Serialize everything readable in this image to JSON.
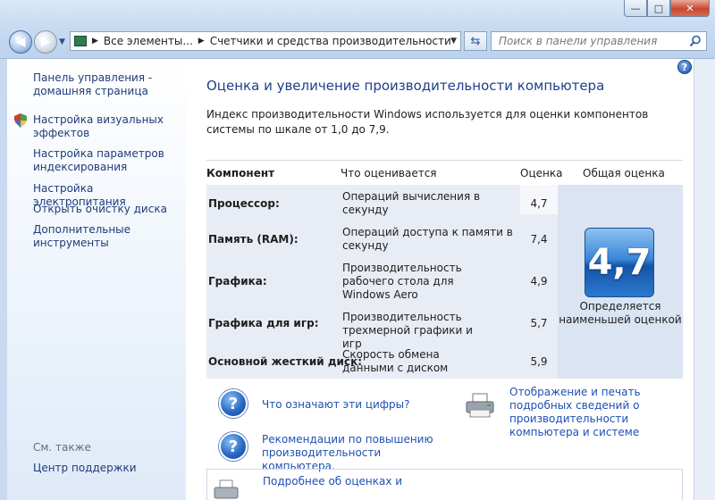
{
  "window": {
    "minimize": "—",
    "maximize": "□",
    "close": "✕"
  },
  "address": {
    "crumb1": "Все элементы...",
    "crumb2": "Счетчики и средства производительности"
  },
  "search": {
    "placeholder": "Поиск в панели управления"
  },
  "sidebar": {
    "items": [
      {
        "label": "Панель управления - домашняя страница"
      },
      {
        "label": "Настройка визуальных эффектов"
      },
      {
        "label": "Настройка параметров индексирования"
      },
      {
        "label": "Настройка электропитания"
      },
      {
        "label": "Открыть очистку диска"
      },
      {
        "label": "Дополнительные инструменты"
      }
    ],
    "see_also": "См. также",
    "support": "Центр поддержки"
  },
  "main": {
    "title": "Оценка и увеличение производительности компьютера",
    "description": "Индекс производительности Windows используется для оценки компонентов системы по шкале от 1,0 до 7,9.",
    "headers": {
      "component": "Компонент",
      "what": "Что оценивается",
      "score": "Оценка",
      "overall": "Общая оценка"
    },
    "rows": [
      {
        "component": "Процессор:",
        "what": "Операций вычисления в секунду",
        "score": "4,7"
      },
      {
        "component": "Память (RAM):",
        "what": "Операций доступа к памяти в секунду",
        "score": "7,4"
      },
      {
        "component": "Графика:",
        "what": "Производительность рабочего стола для Windows Aero",
        "score": "4,9"
      },
      {
        "component": "Графика для игр:",
        "what": "Производительность трехмерной графики и игр",
        "score": "5,7"
      },
      {
        "component": "Основной жесткий диск:",
        "what": "Скорость обмена данными с диском",
        "score": "5,9"
      }
    ],
    "overall_score": "4,7",
    "overall_caption": "Определяется наименьшей оценкой",
    "links": {
      "what_numbers": "Что означают эти цифры?",
      "recommendations": "Рекомендации по повышению производительности компьютера.",
      "print_details": "Отображение и печать подробных сведений о производительности компьютера и системе",
      "more_details": "Подробнее об оценках и"
    }
  }
}
